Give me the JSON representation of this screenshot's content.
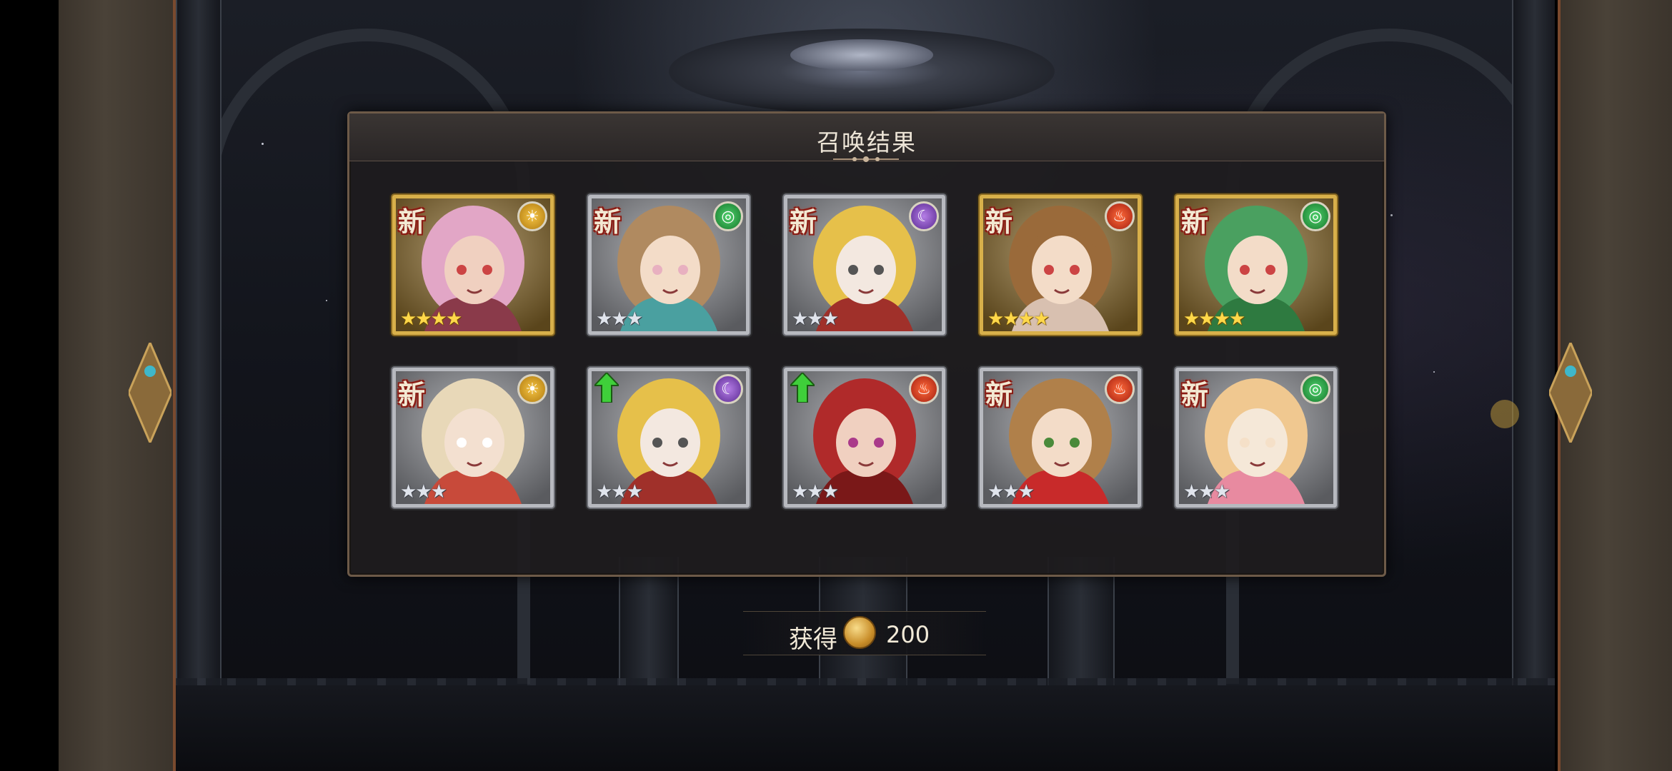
{
  "dialog": {
    "title": "召唤结果"
  },
  "cards": [
    {
      "tag": "新",
      "element": "sun-icon",
      "frame": "gold",
      "stars": "★★★★",
      "star_count": 4
    },
    {
      "tag": "新",
      "element": "wind-icon",
      "frame": "silver",
      "stars": "★★★",
      "star_count": 3
    },
    {
      "tag": "新",
      "element": "moon-icon",
      "frame": "silver",
      "stars": "★★★",
      "star_count": 3
    },
    {
      "tag": "新",
      "element": "fire-icon",
      "frame": "gold",
      "stars": "★★★★",
      "star_count": 4
    },
    {
      "tag": "新",
      "element": "wind-icon",
      "frame": "gold",
      "stars": "★★★★",
      "star_count": 4
    },
    {
      "tag": "新",
      "element": "sun-icon",
      "frame": "silver",
      "stars": "★★★",
      "star_count": 3
    },
    {
      "tag": "",
      "badge": "up-arrow-icon",
      "element": "moon-icon",
      "frame": "silver",
      "stars": "★★★",
      "star_count": 3
    },
    {
      "tag": "",
      "badge": "up-arrow-icon",
      "element": "fire-icon",
      "frame": "silver",
      "stars": "★★★",
      "star_count": 3
    },
    {
      "tag": "新",
      "element": "fire-icon",
      "frame": "silver",
      "stars": "★★★",
      "star_count": 3
    },
    {
      "tag": "新",
      "element": "wind-icon",
      "frame": "silver",
      "stars": "★★★",
      "star_count": 3
    }
  ],
  "reward": {
    "label": "获得",
    "icon": "coin-icon",
    "amount": "200"
  },
  "colors": {
    "gold_frame": "#d8b04a",
    "silver_frame": "#b7b9bf",
    "new_tag_outline": "#8a1c14",
    "up_arrow": "#3fcf3a"
  }
}
